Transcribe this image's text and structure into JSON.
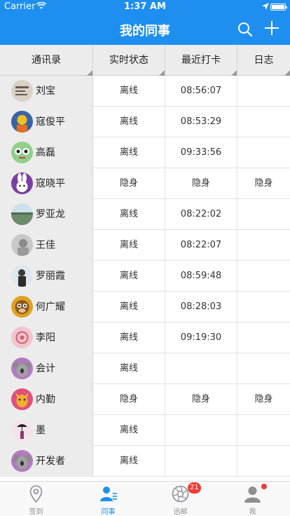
{
  "status_bar": {
    "carrier": "Carrier",
    "time": "1:37 AM"
  },
  "nav": {
    "title": "我的同事",
    "search_icon": "search-icon",
    "add_icon": "plus-icon"
  },
  "table": {
    "columns": [
      "通讯录",
      "实时状态",
      "最近打卡",
      "日志"
    ],
    "rows": [
      {
        "name": "刘宝",
        "status": "离线",
        "last_punch": "08:56:07",
        "log": "",
        "avatar_color": "#d9d2c8"
      },
      {
        "name": "寇俊平",
        "status": "离线",
        "last_punch": "08:53:29",
        "log": "",
        "avatar_color": "#3a63a8"
      },
      {
        "name": "高磊",
        "status": "离线",
        "last_punch": "09:33:56",
        "log": "",
        "avatar_color": "#8fd08a"
      },
      {
        "name": "寇晓平",
        "status": "隐身",
        "last_punch": "隐身",
        "log": "隐身",
        "avatar_color": "#7a3fa0"
      },
      {
        "name": "罗亚龙",
        "status": "离线",
        "last_punch": "08:22:02",
        "log": "",
        "avatar_color": "#8aa4a0"
      },
      {
        "name": "王佳",
        "status": "离线",
        "last_punch": "08:22:07",
        "log": "",
        "avatar_color": "#b8b8b8"
      },
      {
        "name": "罗丽霞",
        "status": "离线",
        "last_punch": "08:59:48",
        "log": "",
        "avatar_color": "#b9c9d9"
      },
      {
        "name": "何广耀",
        "status": "离线",
        "last_punch": "08:28:03",
        "log": "",
        "avatar_color": "#e0a020"
      },
      {
        "name": "李阳",
        "status": "离线",
        "last_punch": "09:19:30",
        "log": "",
        "avatar_color": "#f3c4cc"
      },
      {
        "name": "会计",
        "status": "离线",
        "last_punch": "",
        "log": "",
        "avatar_color": "#b37ac0"
      },
      {
        "name": "内勤",
        "status": "隐身",
        "last_punch": "隐身",
        "log": "隐身",
        "avatar_color": "#e0507a"
      },
      {
        "name": "墨",
        "status": "离线",
        "last_punch": "",
        "log": "",
        "avatar_color": "#f4e3ec"
      },
      {
        "name": "开发者",
        "status": "离线",
        "last_punch": "",
        "log": "",
        "avatar_color": "#b37ac0"
      }
    ]
  },
  "tabbar": {
    "tabs": [
      {
        "label": "签到",
        "icon": "location-pin-icon",
        "active": false
      },
      {
        "label": "同事",
        "icon": "colleagues-icon",
        "active": true
      },
      {
        "label": "迅邮",
        "icon": "shutter-icon",
        "active": false,
        "badge": "21"
      },
      {
        "label": "我",
        "icon": "profile-icon",
        "active": false
      }
    ]
  },
  "colors": {
    "accent": "#1e8ff0",
    "badge": "#f03a3a",
    "header_bg": "#ececec"
  }
}
